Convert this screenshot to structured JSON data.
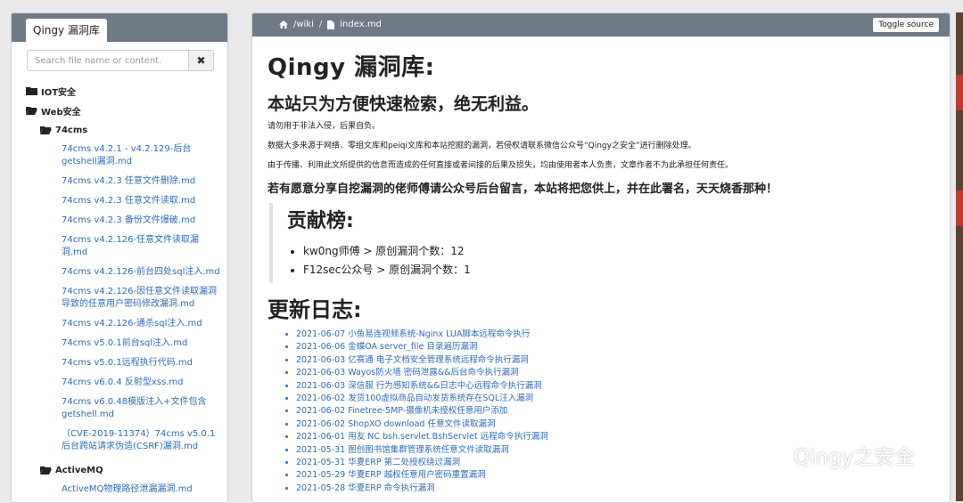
{
  "sidebar": {
    "tab_title": "Qingy 漏洞库",
    "search_placeholder": "Search file name or content.",
    "clear_symbol": "✖",
    "folders": {
      "iot": "IOT安全",
      "web": "Web安全",
      "cms74": "74cms",
      "activemq": "ActiveMQ"
    },
    "files": [
      "74cms v4.2.1 - v4.2.129-后台getshell漏洞.md",
      "74cms v4.2.3 任意文件删除.md",
      "74cms v4.2.3 任意文件读取.md",
      "74cms v4.2.3 备份文件爆破.md",
      "74cms v4.2.126-任意文件读取漏洞.md",
      "74cms v4.2.126-前台四处sql注入.md",
      "74cms v4.2.126-因任意文件读取漏洞导致的任意用户密码修改漏洞.md",
      "74cms v4.2.126-通杀sql注入.md",
      "74cms v5.0.1前台sql注入.md",
      "74cms v5.0.1远程执行代码.md",
      "74cms v6.0.4 反射型xss.md",
      "74cms v6.0.48模版注入+文件包含getshell.md",
      "（CVE-2019-11374）74cms v5.0.1 后台跨站请求伪造(CSRF)漏洞.md"
    ],
    "activemq_first_file": "ActiveMQ物理路径泄漏漏洞.md"
  },
  "topbar": {
    "path_root": "/wiki",
    "separator": "/",
    "file": "index.md",
    "toggle_label": "Toggle source"
  },
  "content": {
    "title": "Qingy 漏洞库:",
    "subtitle": "本站只为方便快速检索，绝无利益。",
    "para1": "请勿用于非法入侵，后果自负。",
    "para2": "数据大多来源于网络、零组文库和peiqi文库和本站挖掘的漏洞，若侵权请联系微信公众号“Qingy之安全”进行删除处理。",
    "para3": "由于传播、利用此文所提供的信息而造成的任何直接或者间接的后果及损失，均由使用者本人负责，文章作者不为此承担任何责任。",
    "emph": "若有愿意分享自挖漏洞的佬师傅请公众号后台留言，本站将把您供上，并在此署名，天天烧香那种！",
    "contrib_title": "贡献榜:",
    "contributors": [
      "kw0ng师傅 > 原创漏洞个数：12",
      "F12sec公众号 > 原创漏洞个数：1"
    ],
    "log_title": "更新日志:",
    "log": [
      "2021-06-07 小鱼易连视频系统-Nginx LUA脚本远程命令执行",
      "2021-06-06 金蝶OA server_file 目录遍历漏洞",
      "2021-06-03 亿赛通 电子文档安全管理系统远程命令执行漏洞",
      "2021-06-03 Wayos防火墙 密码泄露&&后台命令执行漏洞",
      "2021-06-03 深信服 行为感知系统&&日志中心远程命令执行漏洞",
      "2021-06-02 发货100虚拟商品自动发货系统存在SQL注入漏洞",
      "2021-06-02 Finetree-5MP-摄像机未授权任意用户添加",
      "2021-06-02 ShopXO download 任意文件读取漏洞",
      "2021-06-01 用友 NC bsh.servlet.BshServlet 远程命令执行漏洞",
      "2021-05-31 图创图书馆集群管理系统任意文件读取漏洞",
      "2021-05-31 华夏ERP 第二处授权绕过漏洞",
      "2021-05-29 华夏ERP 越权任意用户密码重置漏洞",
      "2021-05-28 华夏ERP 命令执行漏洞"
    ]
  },
  "watermark": {
    "text": "Qingy之安全",
    "icon": "wechat-icon"
  },
  "colors": {
    "header_bar": "#707a86",
    "link": "#2f6bbf"
  }
}
